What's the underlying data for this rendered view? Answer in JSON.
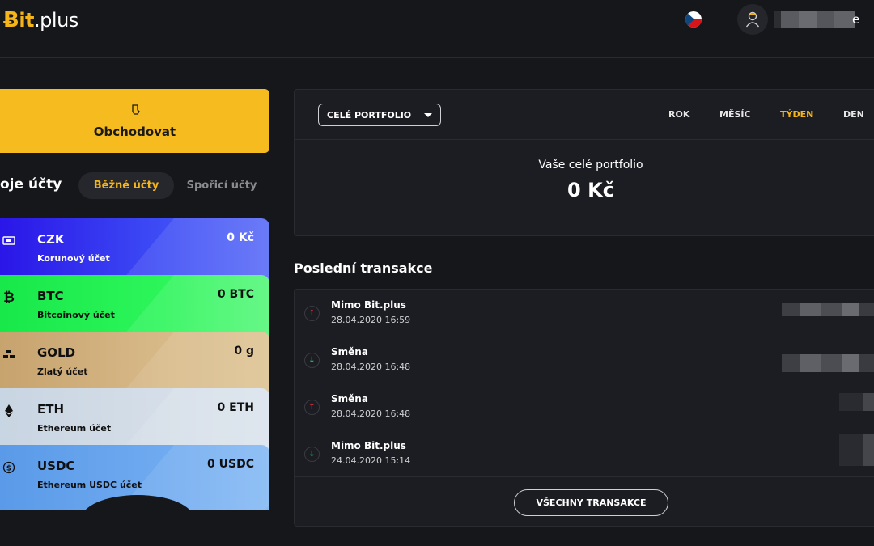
{
  "header": {
    "logo_mark": "Ƀ",
    "logo_accent": "it",
    "logo_rest": ".plus",
    "username_tail": "e",
    "icons": {
      "flag": "czech-flag-icon",
      "user": "user-avatar-icon"
    }
  },
  "sidebar": {
    "trade_button": {
      "label": "Obchodovat",
      "icon": "trade-hand-icon"
    },
    "accounts_title": "oje účty",
    "tabs": [
      "Běžné účty",
      "Spořicí účty"
    ],
    "active_tab": "Běžné účty",
    "accounts": [
      {
        "code": "CZK",
        "name": "Korunový účet",
        "balance": "0 Kč",
        "icon": "cash-icon",
        "color": "#2a16e8"
      },
      {
        "code": "BTC",
        "name": "Bitcoinový účet",
        "balance": "0 BTC",
        "icon": "bitcoin-icon",
        "color": "#18e84a"
      },
      {
        "code": "GOLD",
        "name": "Zlatý účet",
        "balance": "0 g",
        "icon": "gold-bars-icon",
        "color": "#c7a36e"
      },
      {
        "code": "ETH",
        "name": "Ethereum účet",
        "balance": "0 ETH",
        "icon": "ethereum-icon",
        "color": "#c8d5e2"
      },
      {
        "code": "USDC",
        "name": "Ethereum USDC účet",
        "balance": "0 USDC",
        "icon": "usdc-icon",
        "color": "#5a9ae8"
      }
    ]
  },
  "portfolio": {
    "select_value": "CELÉ PORTFOLIO",
    "periods": [
      "ROK",
      "MĚSÍC",
      "TÝDEN",
      "DEN"
    ],
    "active_period": "TÝDEN",
    "title": "Vaše celé portfolio",
    "value": "0 Kč"
  },
  "transactions": {
    "title": "Poslední transakce",
    "items": [
      {
        "name": "Mimo Bit.plus",
        "date": "28.04.2020 16:59",
        "direction": "out"
      },
      {
        "name": "Směna",
        "date": "28.04.2020 16:48",
        "direction": "in"
      },
      {
        "name": "Směna",
        "date": "28.04.2020 16:48",
        "direction": "out"
      },
      {
        "name": "Mimo Bit.plus",
        "date": "24.04.2020 15:14",
        "direction": "in"
      }
    ],
    "all_button": "VŠECHNY TRANSAKCE"
  },
  "colors": {
    "accent": "#f4b41a",
    "out": "#e0313e",
    "in": "#1fc06a",
    "background": "#16171b",
    "panel": "#1c1d22"
  }
}
